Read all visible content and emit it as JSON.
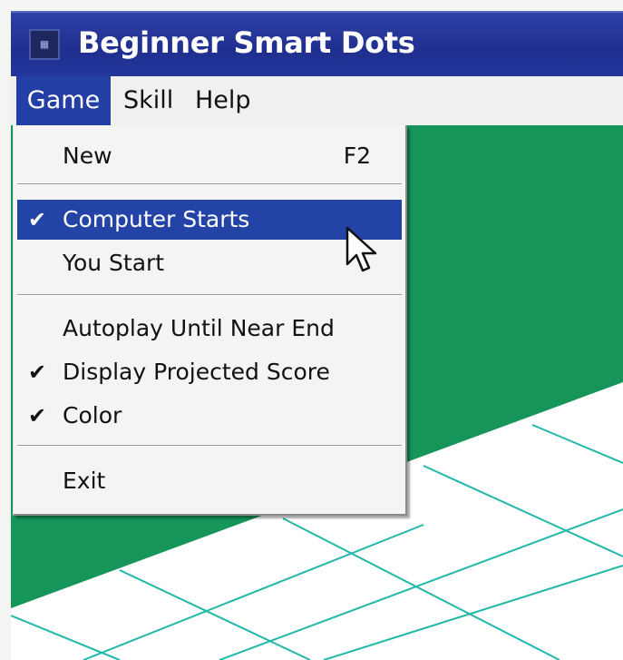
{
  "window": {
    "title": "Beginner Smart Dots",
    "icon": "app-icon"
  },
  "menubar": {
    "items": [
      "Game",
      "Skill",
      "Help"
    ],
    "open": "Game"
  },
  "game_menu": {
    "new": {
      "label": "New",
      "shortcut": "F2"
    },
    "computer_starts": {
      "label": "Computer Starts",
      "checked": true,
      "highlighted": true
    },
    "you_start": {
      "label": "You Start",
      "checked": false
    },
    "autoplay": {
      "label": "Autoplay Until Near End",
      "checked": false
    },
    "display_projected_score": {
      "label": "Display Projected Score",
      "checked": true
    },
    "color": {
      "label": "Color",
      "checked": true
    },
    "exit": {
      "label": "Exit"
    }
  },
  "check_glyph": "✔",
  "colors": {
    "titlebar": "#2a3c9c",
    "highlight": "#2443a6",
    "board": "#16955a",
    "grid": "#22b8a8"
  }
}
